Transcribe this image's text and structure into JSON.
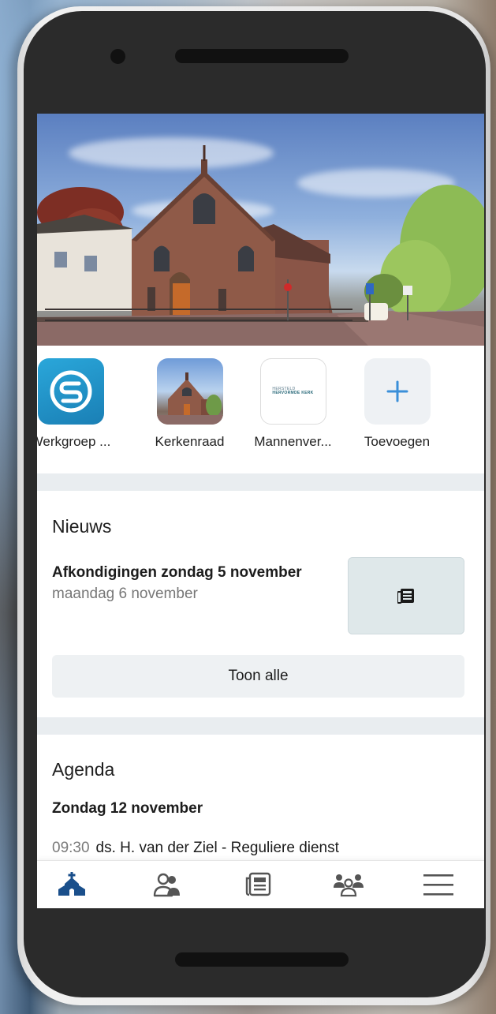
{
  "shortcuts": [
    {
      "label": "Werkgroep ...",
      "icon": "logo-s-icon"
    },
    {
      "label": "Kerkenraad",
      "icon": "church-photo-icon"
    },
    {
      "label": "Mannenver...",
      "icon": "hervormde-kerk-logo-icon",
      "logo_text_small": "HERSTELD",
      "logo_text": "HERVORMDE KERK"
    },
    {
      "label": "Toevoegen",
      "icon": "plus-icon"
    }
  ],
  "news": {
    "title": "Nieuws",
    "item_title": "Afkondigingen zondag 5 november",
    "item_date": "maandag 6 november",
    "thumb_icon": "newspaper-icon",
    "show_all": "Toon alle"
  },
  "agenda": {
    "title": "Agenda",
    "day": "Zondag 12 november",
    "time": "09:30",
    "event": "ds. H. van der Ziel - Reguliere dienst"
  },
  "nav": [
    {
      "icon": "church-icon",
      "active": true
    },
    {
      "icon": "people-icon",
      "active": false
    },
    {
      "icon": "newspaper-icon",
      "active": false
    },
    {
      "icon": "group-icon",
      "active": false
    },
    {
      "icon": "menu-icon",
      "active": false
    }
  ],
  "colors": {
    "accent": "#1a4f8b",
    "plus": "#3a8fd9",
    "divider": "#e9edf0"
  }
}
